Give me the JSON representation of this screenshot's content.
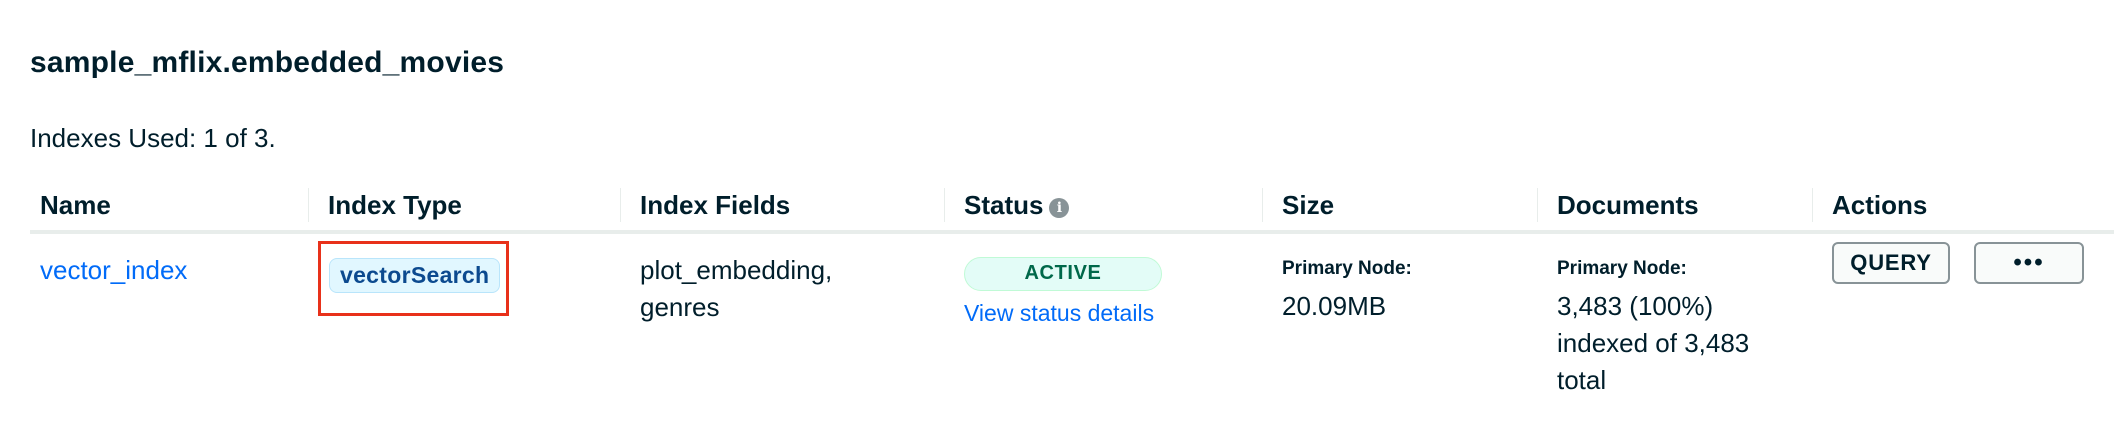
{
  "collection_title": "sample_mflix.embedded_movies",
  "indexes_used": "Indexes Used: 1 of 3.",
  "table": {
    "headers": {
      "name": "Name",
      "index_type": "Index Type",
      "index_fields": "Index Fields",
      "status": "Status",
      "size": "Size",
      "documents": "Documents",
      "actions": "Actions"
    },
    "rows": [
      {
        "name": "vector_index",
        "index_type": "vectorSearch",
        "index_fields_line1": "plot_embedding,",
        "index_fields_line2": "genres",
        "status": "ACTIVE",
        "status_link": "View status details",
        "size_label": "Primary Node:",
        "size_value": "20.09MB",
        "documents_label": "Primary Node:",
        "documents_value_line1": "3,483 (100%)",
        "documents_value_line2": "indexed of 3,483",
        "documents_value_line3": "total",
        "query_label": "QUERY",
        "more_label": "•••"
      }
    ]
  },
  "icons": {
    "status_info": "info-icon",
    "more_actions": "ellipsis-icon"
  },
  "colors": {
    "link": "#016bf8",
    "highlight_box": "#e8311a",
    "active_badge_text": "#00684a",
    "active_badge_bg": "#e3fcf7",
    "type_badge_bg": "#e1f7ff",
    "type_badge_text": "#0c4a8f"
  }
}
